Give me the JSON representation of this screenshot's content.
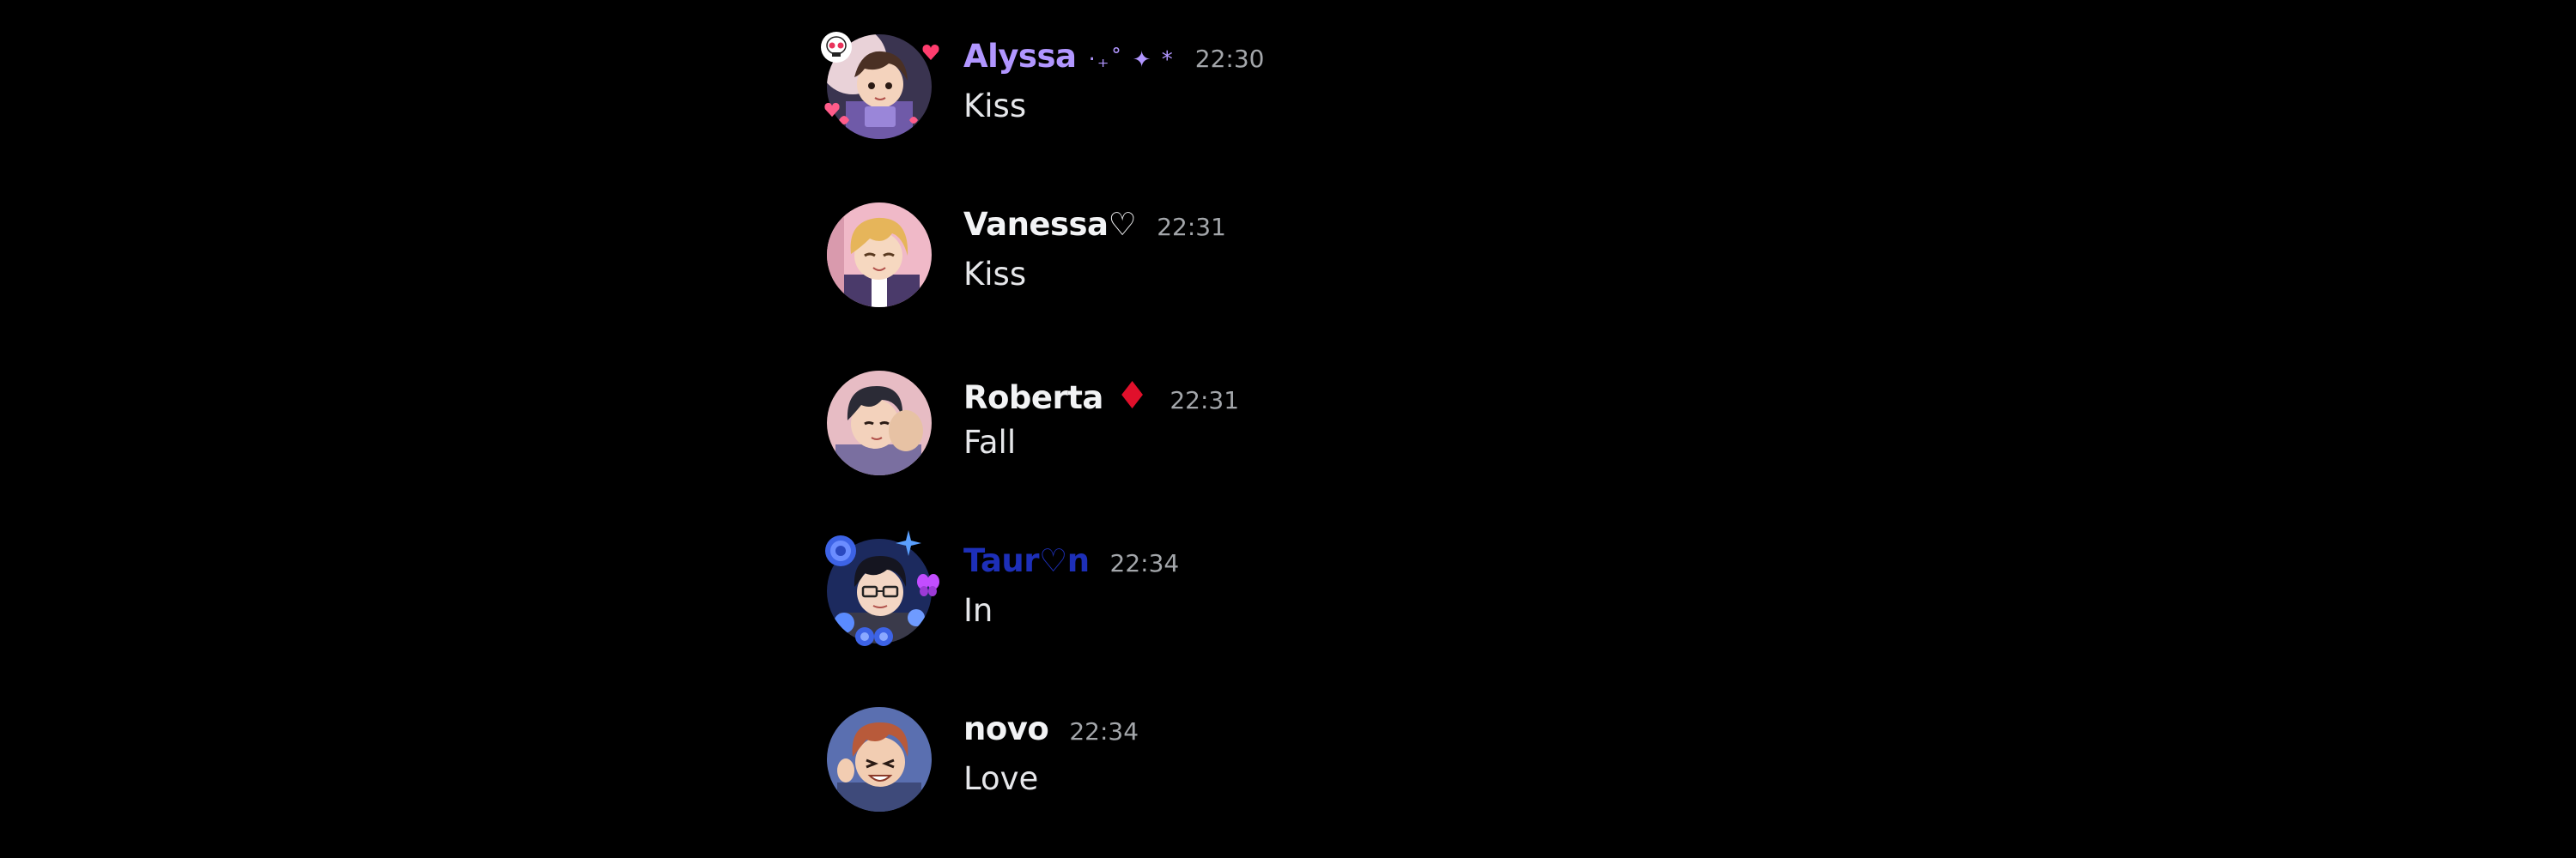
{
  "colors": {
    "background": "#000000",
    "timestamp": "#a3a6aa",
    "text": "#e6e7ea"
  },
  "messages": [
    {
      "username": "Alyssa",
      "username_color": "#b196ff",
      "badge": "‧₊˚ ✦ *",
      "badge_color": "#b196ff",
      "timestamp": "22:30",
      "content": "Kiss",
      "avatar_icon": "anime-boy-avatar-with-hearts"
    },
    {
      "username": "Vanessa♡",
      "username_color": "#f2f3f5",
      "badge": "",
      "timestamp": "22:31",
      "content": "Kiss",
      "avatar_icon": "anime-blond-avatar"
    },
    {
      "username": "Roberta",
      "username_color": "#f2f3f5",
      "badge": "♦",
      "badge_color": "#e0102b",
      "timestamp": "22:31",
      "content": "Fall",
      "avatar_icon": "anime-dark-hair-avatar"
    },
    {
      "username": "Taur♡n",
      "username_color": "#1d2fb8",
      "badge": "",
      "timestamp": "22:34",
      "content": "In",
      "avatar_icon": "anime-glasses-avatar-with-blue-roses"
    },
    {
      "username": "novo",
      "username_color": "#f2f3f5",
      "badge": "",
      "timestamp": "22:34",
      "content": "Love",
      "avatar_icon": "anime-red-hair-avatar"
    }
  ]
}
